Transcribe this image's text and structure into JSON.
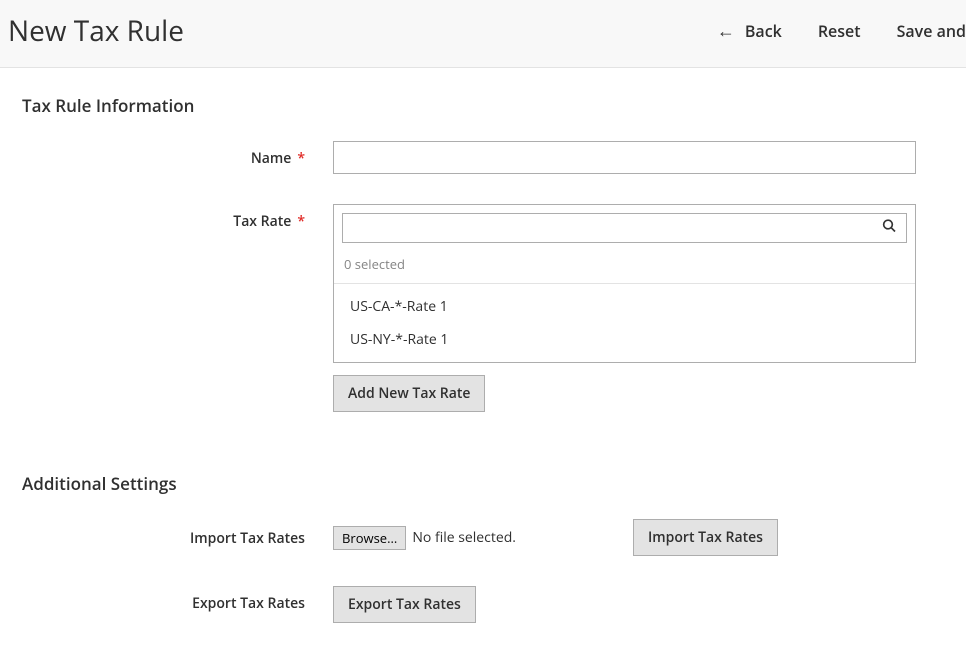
{
  "header": {
    "title": "New Tax Rule",
    "back_label": "Back",
    "reset_label": "Reset",
    "save_label": "Save and"
  },
  "section": {
    "info_heading": "Tax Rule Information",
    "additional_heading": "Additional Settings"
  },
  "fields": {
    "name": {
      "label": "Name",
      "value": ""
    },
    "tax_rate": {
      "label": "Tax Rate",
      "search_value": "",
      "selected_text": "0 selected",
      "options": [
        "US-CA-*-Rate 1",
        "US-NY-*-Rate 1"
      ],
      "add_button": "Add New Tax Rate"
    },
    "import": {
      "label": "Import Tax Rates",
      "browse_label": "Browse...",
      "file_status": "No file selected.",
      "action_label": "Import Tax Rates"
    },
    "export": {
      "label": "Export Tax Rates",
      "action_label": "Export Tax Rates"
    }
  }
}
